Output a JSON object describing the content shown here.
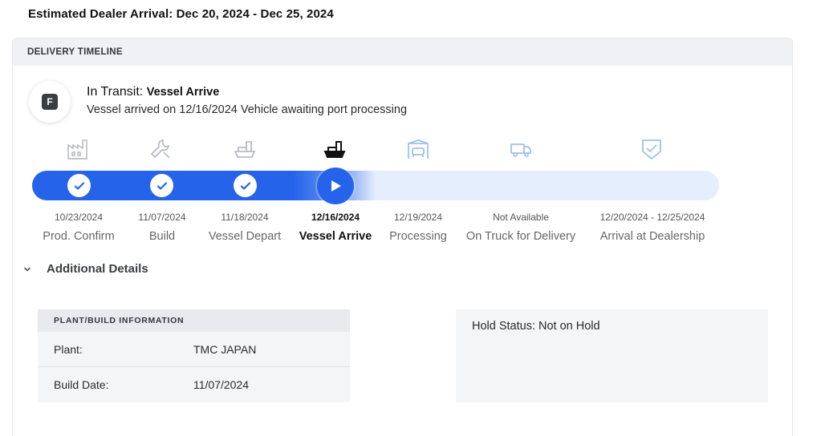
{
  "estimated_arrival": "Estimated Dealer Arrival: Dec 20, 2024 - Dec 25, 2024",
  "timeline": {
    "header": "DELIVERY TIMELINE",
    "status_avatar_letter": "F",
    "status_title_prefix": "In Transit:",
    "status_title_stage": "Vessel Arrive",
    "status_description": "Vessel arrived on 12/16/2024 Vehicle awaiting port processing",
    "progress_fraction": 0.5,
    "accent_color": "#2563eb",
    "steps": [
      {
        "date": "10/23/2024",
        "label": "Prod. Confirm",
        "icon": "factory-icon",
        "state": "complete"
      },
      {
        "date": "11/07/2024",
        "label": "Build",
        "icon": "wrench-icon",
        "state": "complete"
      },
      {
        "date": "11/18/2024",
        "label": "Vessel Depart",
        "icon": "ship-icon",
        "state": "complete"
      },
      {
        "date": "12/16/2024",
        "label": "Vessel Arrive",
        "icon": "ship-icon",
        "state": "current"
      },
      {
        "date": "12/19/2024",
        "label": "Processing",
        "icon": "car-garage-icon",
        "state": "pending"
      },
      {
        "date": "Not Available",
        "label": "On Truck for Delivery",
        "icon": "truck-icon",
        "state": "pending"
      },
      {
        "date": "12/20/2024 - 12/25/2024",
        "label": "Arrival at Dealership",
        "icon": "shield-check-icon",
        "state": "pending"
      }
    ]
  },
  "additional_details": {
    "toggle_label": "Additional Details",
    "plant_info": {
      "header": "PLANT/BUILD INFORMATION",
      "rows": [
        {
          "key": "Plant:",
          "value": "TMC JAPAN"
        },
        {
          "key": "Build Date:",
          "value": "11/07/2024"
        }
      ]
    },
    "hold_status": "Hold Status: Not on Hold"
  }
}
